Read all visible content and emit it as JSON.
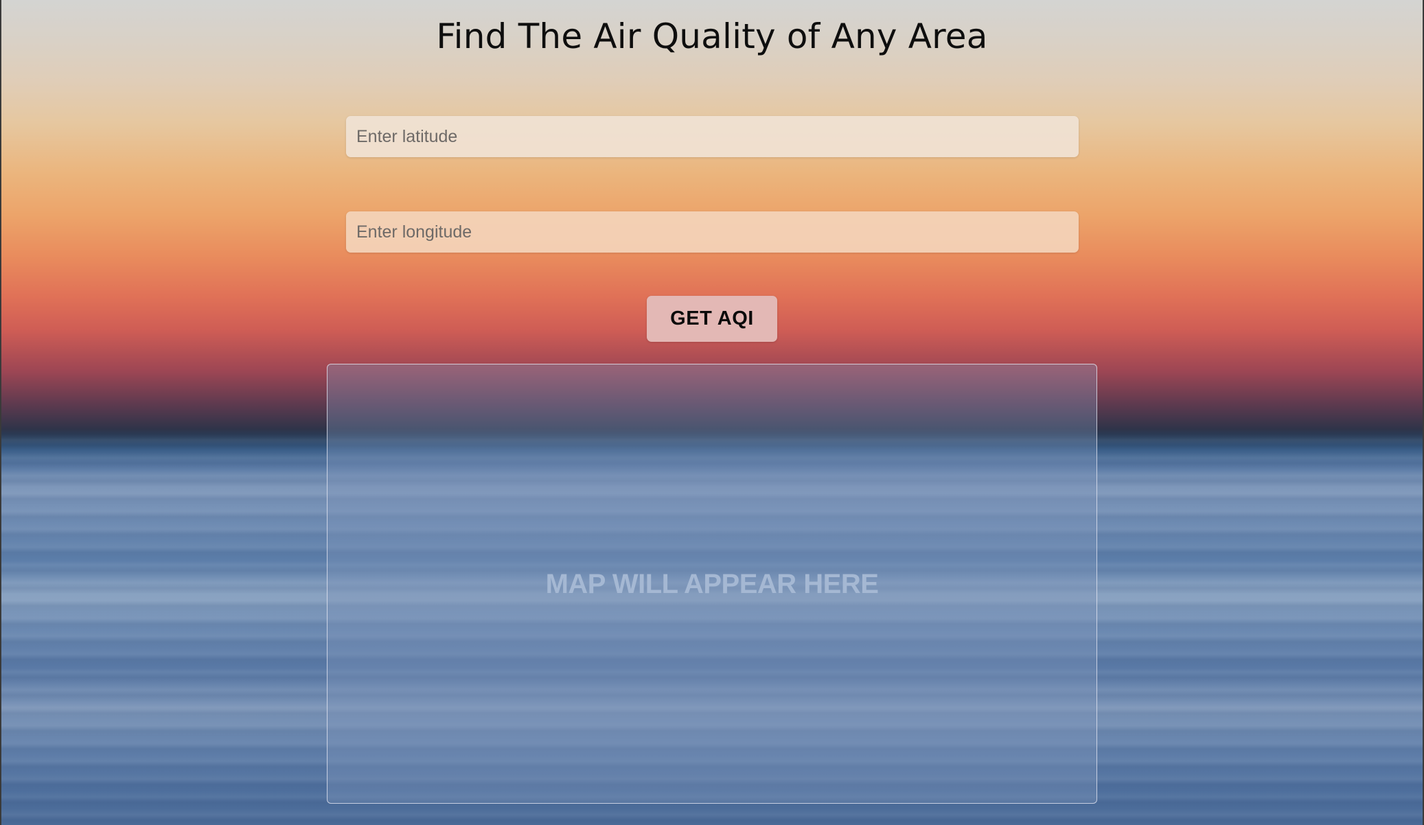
{
  "header": {
    "title": "Find The Air Quality of Any Area"
  },
  "form": {
    "latitude": {
      "placeholder": "Enter latitude",
      "value": ""
    },
    "longitude": {
      "placeholder": "Enter longitude",
      "value": ""
    },
    "submit_label": "GET AQI"
  },
  "map": {
    "placeholder_text": "MAP WILL APPEAR HERE"
  },
  "colors": {
    "button_bg": "#e3b8b5",
    "title_text": "#0e0e0e",
    "map_placeholder_text": "#a5b8d3"
  }
}
